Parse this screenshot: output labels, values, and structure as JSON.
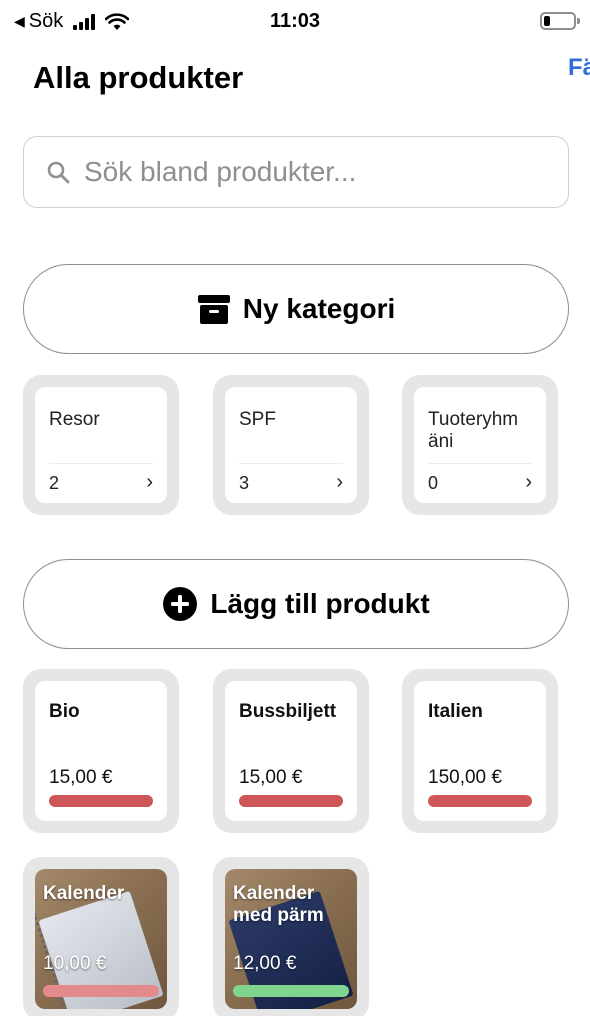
{
  "status_bar": {
    "back_label": "Sök",
    "time": "11:03"
  },
  "nav": {
    "title": "Alla produkter",
    "right_action_partial": "Fä"
  },
  "search": {
    "placeholder": "Sök bland produkter...",
    "value": ""
  },
  "new_category_button": {
    "label": "Ny kategori",
    "icon": "archive-box-icon"
  },
  "categories": [
    {
      "name": "Resor",
      "count": "2",
      "chevron": "›"
    },
    {
      "name": "SPF",
      "count": "3",
      "chevron": "›"
    },
    {
      "name": "Tuoteryhm äni",
      "count": "0",
      "chevron": "›"
    }
  ],
  "add_product_button": {
    "label": "Lägg till produkt",
    "icon": "plus-circle-icon"
  },
  "products": [
    {
      "name": "Bio",
      "price": "15,00 €",
      "bar_color": "#cf5656"
    },
    {
      "name": "Bussbiljett",
      "price": "15,00 €",
      "bar_color": "#cf5656"
    },
    {
      "name": "Italien",
      "price": "150,00 €",
      "bar_color": "#cf5656"
    },
    {
      "name": "Kalender",
      "price": "10,00 €",
      "bar_color": "#e58a8a",
      "image": "notebook-photo"
    },
    {
      "name": "Kalender med pärm",
      "price": "12,00 €",
      "bar_color": "#7fd48e",
      "image": "notebook-dark-cover-photo"
    }
  ],
  "colors": {
    "accent": "#2f6ed9",
    "tile_background": "#e6e6e6"
  }
}
